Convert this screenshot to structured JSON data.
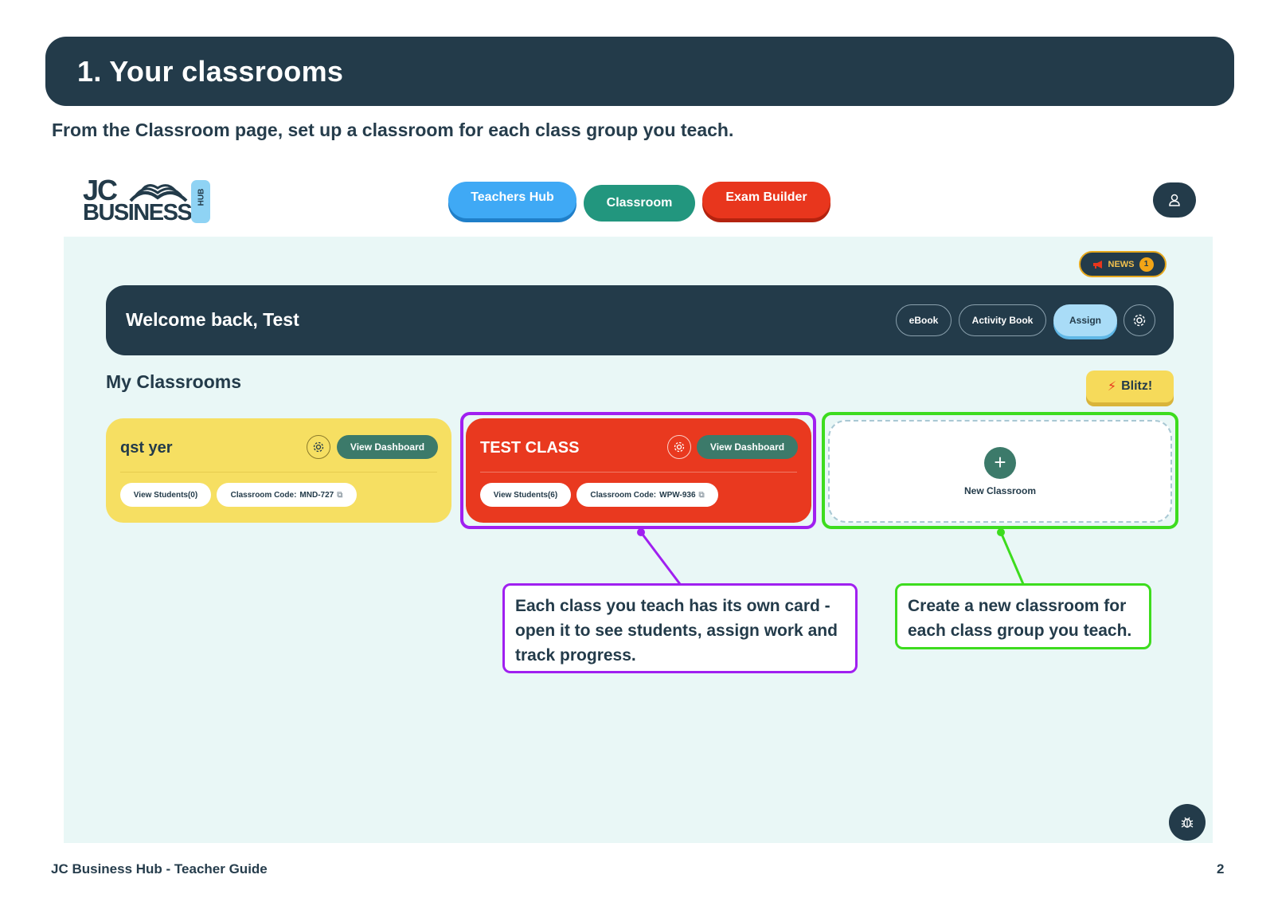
{
  "doc": {
    "heading": "1. Your classrooms",
    "subtitle": "From the Classroom page, set up a classroom for each class group you teach.",
    "footer_left": "JC Business Hub - Teacher Guide",
    "page_number": "2"
  },
  "app": {
    "logo": {
      "line1": "JC",
      "line2": "BUSINESS",
      "badge": "HUB"
    },
    "nav": {
      "teachers_hub": "Teachers Hub",
      "classroom": "Classroom",
      "exam_builder": "Exam Builder"
    },
    "news": {
      "label": "NEWS",
      "count": "1"
    },
    "welcome": {
      "greeting": "Welcome back, Test",
      "ebook": "eBook",
      "activity_book": "Activity Book",
      "assign": "Assign"
    },
    "my_classrooms": "My Classrooms",
    "blitz": "Blitz!",
    "classrooms": [
      {
        "name": "qst yer",
        "dashboard": "View Dashboard",
        "students": "View Students(0)",
        "code_label": "Classroom Code:",
        "code": "MND-727",
        "color": "#f6df62"
      },
      {
        "name": "TEST CLASS",
        "dashboard": "View Dashboard",
        "students": "View Students(6)",
        "code_label": "Classroom Code:",
        "code": "WPW-936",
        "color": "#e9391f"
      }
    ],
    "new_classroom": "New Classroom"
  },
  "callouts": {
    "class_card": "Each class you teach has its own card - open it to see students, assign work and track progress.",
    "new_classroom": "Create a new classroom for each class group you teach.",
    "purple": "#a020f0",
    "green": "#3ddc1e"
  },
  "colors": {
    "navy": "#233b4a",
    "app_background": "#e9f7f6"
  }
}
